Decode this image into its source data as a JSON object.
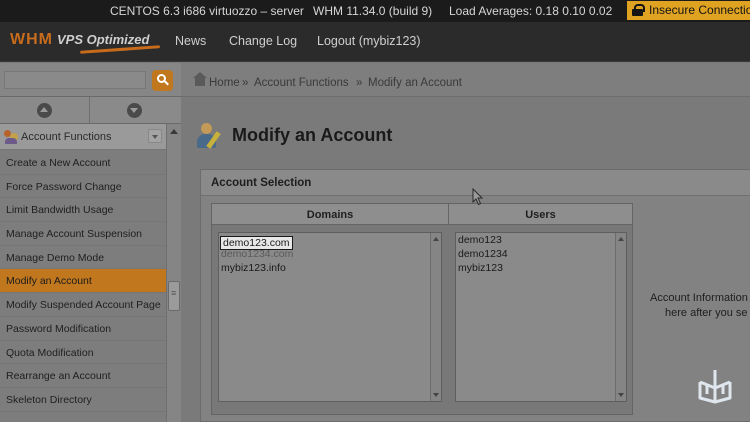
{
  "statusbar": {
    "os": "CENTOS 6.3 i686 virtuozzo – server",
    "version": "WHM 11.34.0 (build 9)",
    "load": "Load Averages: 0.18 0.10 0.02",
    "insecure": "Insecure Connection"
  },
  "header": {
    "logo_main": "WHM",
    "logo_sub": "VPS Optimized",
    "nav": [
      "News",
      "Change Log",
      "Logout (mybiz123)"
    ]
  },
  "sidebar": {
    "section_label": "Account Functions",
    "items": [
      "Create a New Account",
      "Force Password Change",
      "Limit Bandwidth Usage",
      "Manage Account Suspension",
      "Manage Demo Mode",
      "Modify an Account",
      "Modify Suspended Account Page",
      "Password Modification",
      "Quota Modification",
      "Rearrange an Account",
      "Skeleton Directory"
    ],
    "active_index": 5
  },
  "breadcrumb": {
    "home": "Home",
    "sep": "»",
    "section": "Account Functions",
    "page": "Modify an Account"
  },
  "page": {
    "title": "Modify an Account"
  },
  "panel": {
    "title": "Account Selection",
    "domains_header": "Domains",
    "users_header": "Users",
    "domains": [
      "demo123.com",
      "demo1234.com",
      "mybiz123.info"
    ],
    "users": [
      "demo123",
      "demo1234",
      "mybiz123"
    ],
    "info_line1": "Account Information",
    "info_line2": "here after you se"
  },
  "colors": {
    "accent": "#c0771e",
    "header_bg": "#2b2b2b",
    "statusbar_bg": "#1b1b1b"
  }
}
